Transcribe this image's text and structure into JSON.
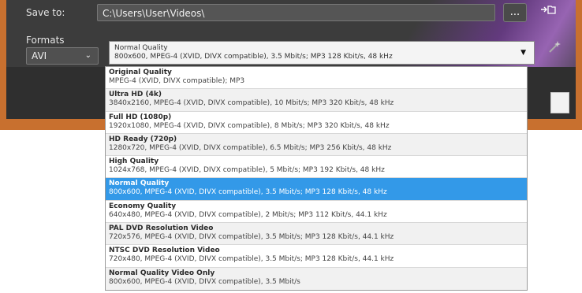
{
  "save_to": {
    "label": "Save to:",
    "path": "C:\\Users\\User\\Videos\\",
    "browse_label": "...",
    "open_icon": "open-folder-icon"
  },
  "formats": {
    "label": "Formats",
    "selected_format": "AVI",
    "quality_title": "Normal Quality",
    "quality_desc": "800x600, MPEG-4 (XVID, DIVX compatible), 3.5 Mbit/s; MP3 128 Kbit/s, 48 kHz",
    "wand_icon": "magic-wand-icon"
  },
  "options": [
    {
      "title": "Original Quality",
      "desc": "MPEG-4 (XVID, DIVX compatible); MP3"
    },
    {
      "title": "Ultra HD (4k)",
      "desc": "3840x2160, MPEG-4 (XVID, DIVX compatible), 10 Mbit/s; MP3 320 Kbit/s, 48 kHz"
    },
    {
      "title": "Full HD (1080p)",
      "desc": "1920x1080, MPEG-4 (XVID, DIVX compatible), 8 Mbit/s; MP3 320 Kbit/s, 48 kHz"
    },
    {
      "title": "HD Ready (720p)",
      "desc": "1280x720, MPEG-4 (XVID, DIVX compatible), 6.5 Mbit/s; MP3 256 Kbit/s, 48 kHz"
    },
    {
      "title": "High Quality",
      "desc": "1024x768, MPEG-4 (XVID, DIVX compatible), 5 Mbit/s; MP3 192 Kbit/s, 48 kHz"
    },
    {
      "title": "Normal Quality",
      "desc": "800x600, MPEG-4 (XVID, DIVX compatible), 3.5 Mbit/s; MP3 128 Kbit/s, 48 kHz"
    },
    {
      "title": "Economy Quality",
      "desc": "640x480, MPEG-4 (XVID, DIVX compatible), 2 Mbit/s; MP3 112 Kbit/s, 44.1 kHz"
    },
    {
      "title": "PAL DVD Resolution Video",
      "desc": "720x576, MPEG-4 (XVID, DIVX compatible), 3.5 Mbit/s; MP3 128 Kbit/s, 44.1 kHz"
    },
    {
      "title": "NTSC DVD Resolution Video",
      "desc": "720x480, MPEG-4 (XVID, DIVX compatible), 3.5 Mbit/s; MP3 128 Kbit/s, 44.1 kHz"
    },
    {
      "title": "Normal Quality Video Only",
      "desc": "800x600, MPEG-4 (XVID, DIVX compatible), 3.5 Mbit/s"
    }
  ],
  "selected_option": "Normal Quality"
}
